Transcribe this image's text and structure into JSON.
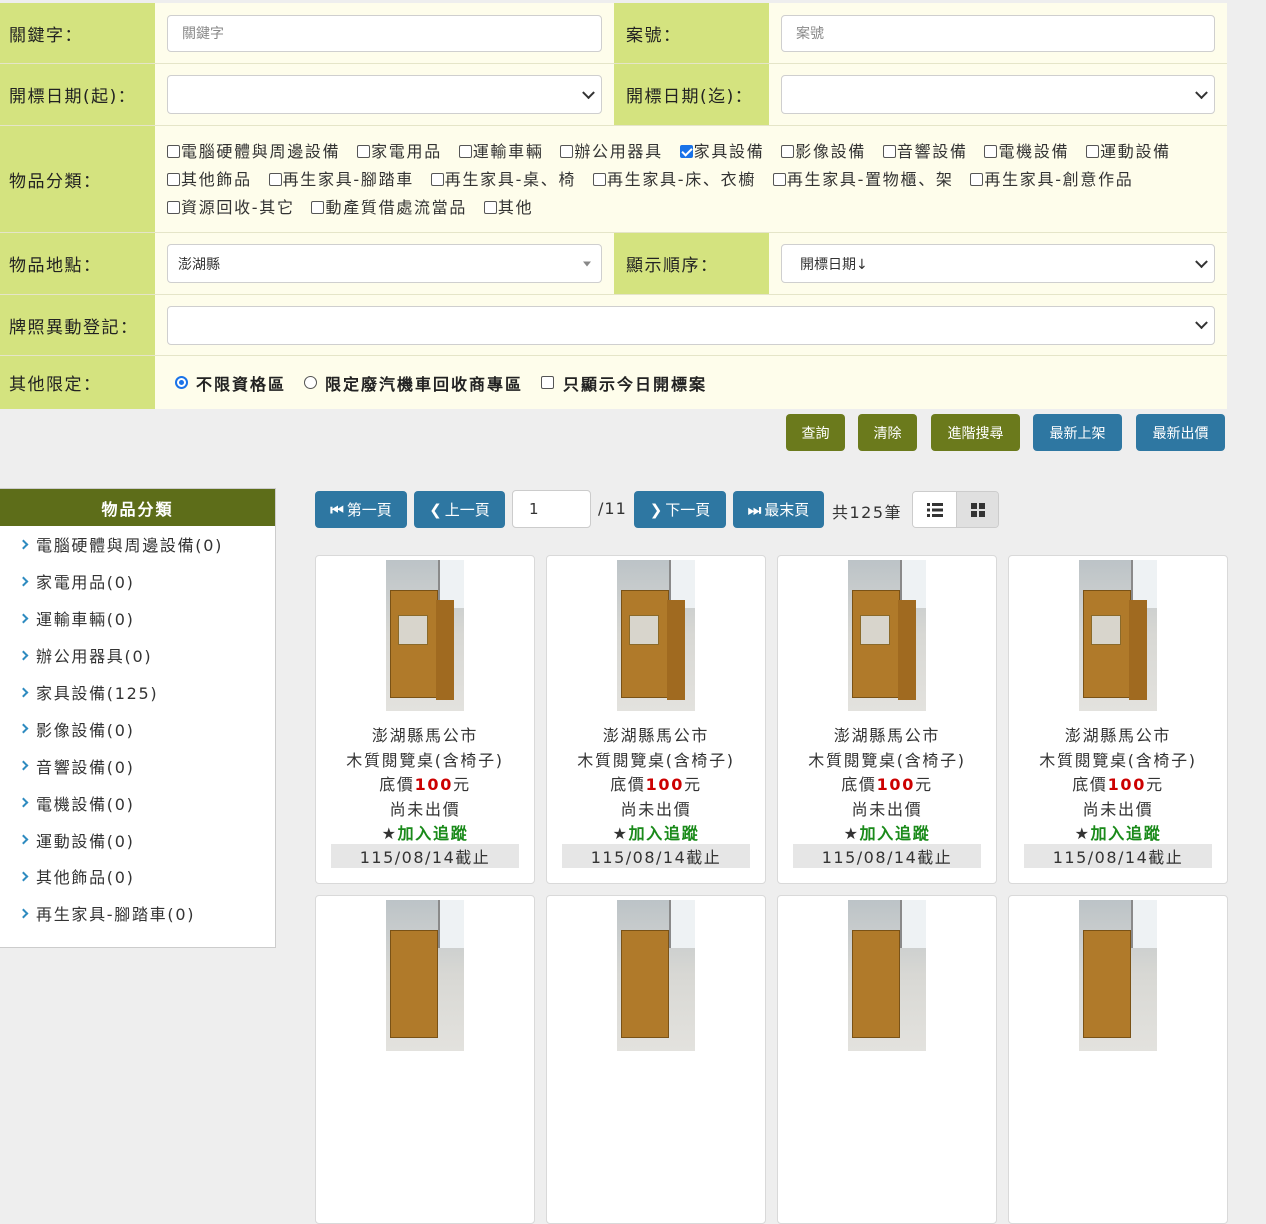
{
  "form": {
    "keyword_label": "關鍵字：",
    "keyword_placeholder": "關鍵字",
    "case_label": "案號：",
    "case_placeholder": "案號",
    "start_date_label": "開標日期(起)：",
    "end_date_label": "開標日期(迄)：",
    "category_label": "物品分類：",
    "categories": [
      {
        "label": "電腦硬體與周邊設備",
        "checked": false
      },
      {
        "label": "家電用品",
        "checked": false
      },
      {
        "label": "運輸車輛",
        "checked": false
      },
      {
        "label": "辦公用器具",
        "checked": false
      },
      {
        "label": "家具設備",
        "checked": true
      },
      {
        "label": "影像設備",
        "checked": false
      },
      {
        "label": "音響設備",
        "checked": false
      },
      {
        "label": "電機設備",
        "checked": false
      },
      {
        "label": "運動設備",
        "checked": false
      },
      {
        "label": "其他飾品",
        "checked": false
      },
      {
        "label": "再生家具-腳踏車",
        "checked": false
      },
      {
        "label": "再生家具-桌、椅",
        "checked": false
      },
      {
        "label": "再生家具-床、衣櫥",
        "checked": false
      },
      {
        "label": "再生家具-置物櫃、架",
        "checked": false
      },
      {
        "label": "再生家具-創意作品",
        "checked": false
      },
      {
        "label": "資源回收-其它",
        "checked": false
      },
      {
        "label": "動產質借處流當品",
        "checked": false
      },
      {
        "label": "其他",
        "checked": false
      }
    ],
    "location_label": "物品地點：",
    "location_value": "澎湖縣",
    "order_label": "顯示順序：",
    "order_value": "開標日期↓",
    "license_label": "牌照異動登記：",
    "other_label": "其他限定：",
    "other_options": [
      "不限資格區",
      "限定廢汽機車回收商專區",
      "只顯示今日開標案"
    ]
  },
  "actions": {
    "query": "查詢",
    "clear": "清除",
    "advanced": "進階搜尋",
    "newest": "最新上架",
    "latest_bid": "最新出價"
  },
  "sidebar": {
    "title": "物品分類",
    "items": [
      "電腦硬體與周邊設備(0)",
      "家電用品(0)",
      "運輸車輛(0)",
      "辦公用器具(0)",
      "家具設備(125)",
      "影像設備(0)",
      "音響設備(0)",
      "電機設備(0)",
      "運動設備(0)",
      "其他飾品(0)",
      "再生家具-腳踏車(0)"
    ]
  },
  "pager": {
    "first": "第一頁",
    "prev": "上一頁",
    "page": "1",
    "total_pages": "/11",
    "next": "下一頁",
    "last": "最末頁",
    "count": "共125筆"
  },
  "card": {
    "location": "澎湖縣馬公市",
    "name": "木質閱覽桌(含椅子)",
    "price_prefix": "底價",
    "price": "100",
    "price_suffix": "元",
    "bid_status": "尚未出價",
    "track": "加入追蹤",
    "deadline": "115/08/14截止"
  }
}
